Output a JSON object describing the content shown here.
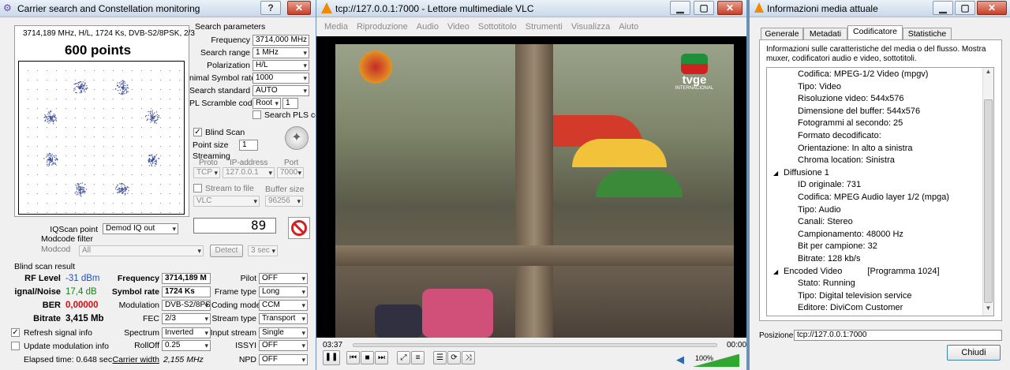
{
  "win1": {
    "title": "Carrier search and Constellation monitoring",
    "help": "?",
    "close": "✕",
    "info_line": "3714,189 MHz, H/L, 1724 Ks, DVB-S2/8PSK, 2/3",
    "points": "600 points",
    "sp_title": "Search parameters",
    "freq_label": "Frequency",
    "freq_value": "3714,000 MHz",
    "range_label": "Search range",
    "range_value": "1 MHz",
    "pol_label": "Polarization",
    "pol_value": "H/L",
    "msr_label": "nimal Symbol rate",
    "msr_value": "1000",
    "std_label": "Search standard",
    "std_value": "AUTO",
    "pls_label": "PL Scramble code",
    "pls_value": "Root",
    "pls_num": "1",
    "pls_search": "Search PLS cc",
    "blind_label": "Blind Scan",
    "pointsize_label": "Point size",
    "pointsize_value": "1",
    "streaming_label": "Streaming",
    "proto_label": "Proto",
    "ip_label": "IP-address",
    "port_label": "Port",
    "proto_value": "TCP",
    "ip_value": "127.0.0.1",
    "port_value": "7000",
    "stream_file_label": "Stream to file",
    "buffer_label": "Buffer size",
    "vlc_value": "VLC",
    "buffer_value": "96256",
    "counter": "89",
    "iq_label": "IQScan point",
    "iq_value": "Demod IQ out",
    "modcode_filter": "Modcode filter",
    "modcode_label": "Modcod",
    "modcode_value": "All",
    "detect": "Detect",
    "sec_value": "3 sec",
    "bsr_title": "Blind scan result",
    "rf_label": "RF Level",
    "rf_value": "-31 dBm",
    "sn_label": "ignal/Noise",
    "sn_value": "17,4 dB",
    "ber_label": "BER",
    "ber_value": "0,00000",
    "bitrate_label": "Bitrate",
    "bitrate_value": "3,415 Mb",
    "r_freq_label": "Frequency",
    "r_freq_value": "3714,189 M",
    "r_sr_label": "Symbol rate",
    "r_sr_value": "1724 Ks",
    "mod_label": "Modulation",
    "mod_value": "DVB-S2/8PS",
    "fec_label": "FEC",
    "fec_value": "2/3",
    "spectrum_label": "Spectrum",
    "spectrum_value": "Inverted",
    "rolloff_label": "RollOff",
    "rolloff_value": "0.25",
    "cw_label": "Carrier width",
    "cw_value": "2,155 MHz",
    "pilot_label": "Pilot",
    "pilot_value": "OFF",
    "frame_label": "Frame type",
    "frame_value": "Long",
    "coding_label": "Coding mode",
    "coding_value": "CCM",
    "stype_label": "Stream type",
    "stype_value": "Transport",
    "istream_label": "Input stream",
    "istream_value": "Single",
    "issyi_label": "ISSYI",
    "issyi_value": "OFF",
    "npd_label": "NPD",
    "npd_value": "OFF",
    "refresh_label": "Refresh signal info",
    "update_label": "Update modulation info",
    "elapsed": "Elapsed time: 0.648 sec"
  },
  "vlc": {
    "title": "tcp://127.0.0.1:7000 - Lettore multimediale VLC",
    "menu": [
      "Media",
      "Riproduzione",
      "Audio",
      "Video",
      "Sottotitolo",
      "Strumenti",
      "Visualizza",
      "Aiuto"
    ],
    "logo": "tvge",
    "logo_sub": "INTERNACIONAL",
    "time_elapsed": "03:37",
    "time_total": "00:00",
    "volume": "100%",
    "min": "▁",
    "max": "▢",
    "close": "✕"
  },
  "info": {
    "title": "Informazioni media attuale",
    "tabs": [
      "Generale",
      "Metadati",
      "Codificatore",
      "Statistiche"
    ],
    "desc": "Informazioni sulle caratteristiche del media o del flusso. Mostra muxer, codificatori audio e video, sottotitoli.",
    "tree": [
      "Codifica: MPEG-1/2 Video (mpgv)",
      "Tipo: Video",
      "Risoluzione video: 544x576",
      "Dimensione del buffer: 544x576",
      "Fotogrammi al secondo: 25",
      "Formato decodificato:",
      "Orientazione: In alto a sinistra",
      "Chroma location: Sinistra",
      "Diffusione 1",
      "ID originale: 731",
      "Codifica: MPEG Audio layer 1/2 (mpga)",
      "Tipo: Audio",
      "Canali: Stereo",
      "Campionamento: 48000 Hz",
      "Bit per campione: 32",
      "Bitrate: 128 kb/s",
      "Encoded Video",
      "Stato: Running",
      "Tipo: Digital television service",
      "Editore: DiviCom Customer"
    ],
    "program": "[Programma 1024]",
    "pos_label": "Posizione:",
    "pos_value": "tcp://127.0.0.1:7000",
    "close_btn": "Chiudi",
    "min": "▁",
    "max": "▢",
    "close": "✕"
  },
  "colors": {
    "rf": "#1f4fc7",
    "sn": "#1a7f1a",
    "ber": "#d01010"
  }
}
